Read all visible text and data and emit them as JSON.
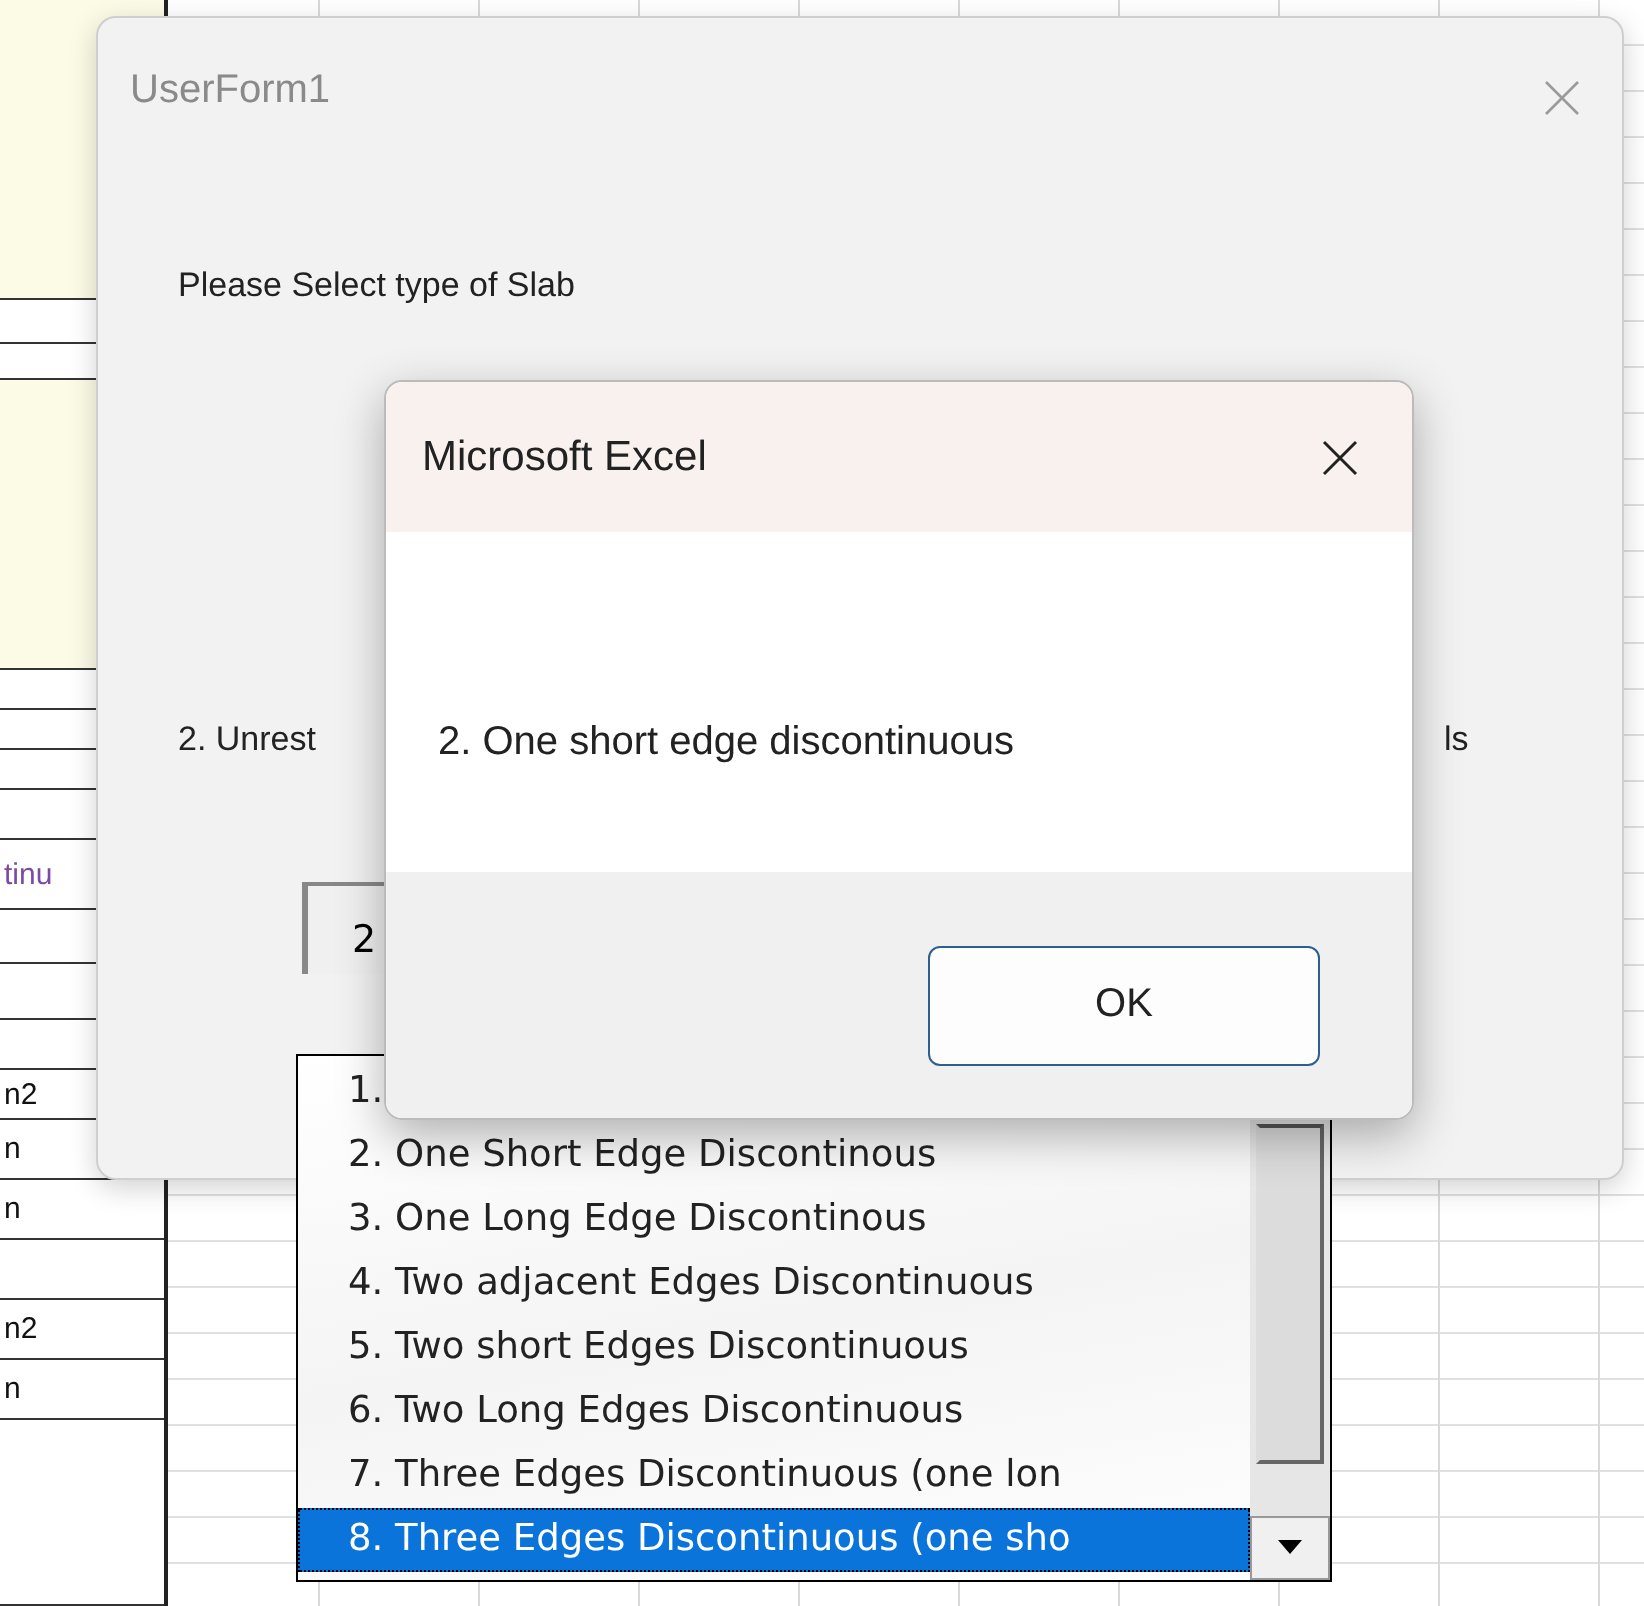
{
  "sheet": {
    "cells": [
      {
        "text": "tinu",
        "kind": "label"
      },
      {
        "text": "n2",
        "kind": "unit"
      },
      {
        "text": "n",
        "kind": "unit"
      },
      {
        "text": "n",
        "kind": "unit"
      },
      {
        "text": "n2",
        "kind": "unit"
      },
      {
        "text": "n",
        "kind": "unit"
      }
    ]
  },
  "userform": {
    "title": "UserForm1",
    "prompt": "Please Select type of Slab",
    "label_parts": [
      "2. Unrest",
      "ls"
    ],
    "combo": {
      "value": "2"
    },
    "list": [
      {
        "label": "1.",
        "selected": false
      },
      {
        "label": "2. One Short Edge Discontinous",
        "selected": false
      },
      {
        "label": "3. One Long Edge Discontinous",
        "selected": false
      },
      {
        "label": "4. Two adjacent Edges Discontinuous",
        "selected": false
      },
      {
        "label": "5. Two short Edges Discontinuous",
        "selected": false
      },
      {
        "label": "6. Two Long Edges Discontinuous",
        "selected": false
      },
      {
        "label": "7. Three Edges Discontinuous (one lon",
        "selected": false
      },
      {
        "label": "8. Three Edges Discontinuous (one sho",
        "selected": true
      }
    ]
  },
  "msgbox": {
    "title": "Microsoft Excel",
    "message": "2. One short edge discontinuous",
    "button": "OK"
  }
}
